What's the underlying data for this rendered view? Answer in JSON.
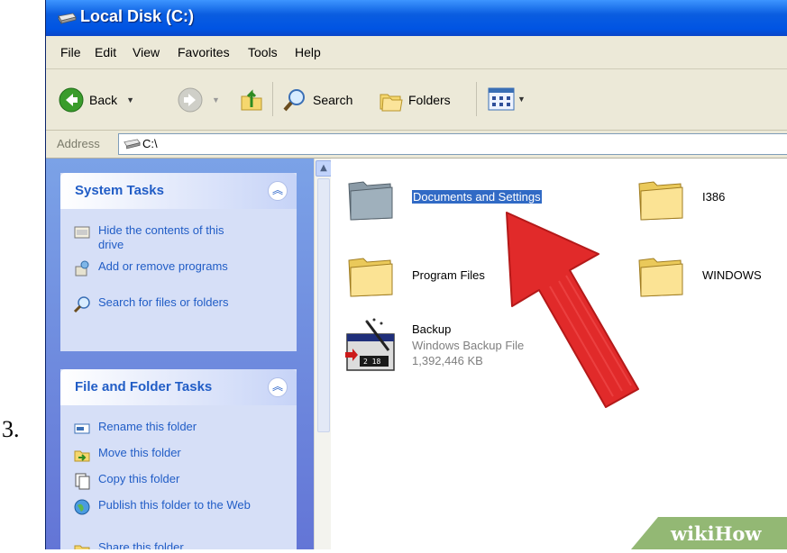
{
  "step_number": "3.",
  "window": {
    "title": "Local Disk (C:)"
  },
  "menu": [
    "File",
    "Edit",
    "View",
    "Favorites",
    "Tools",
    "Help"
  ],
  "toolbar": {
    "back_label": "Back",
    "search_label": "Search",
    "folders_label": "Folders"
  },
  "address": {
    "label": "Address",
    "value": "C:\\"
  },
  "system_tasks": {
    "title": "System Tasks",
    "items": [
      "Hide the contents of this drive",
      "Add or remove programs",
      "Search for files or folders"
    ]
  },
  "file_folder_tasks": {
    "title": "File and Folder Tasks",
    "items": [
      "Rename this folder",
      "Move this folder",
      "Copy this folder",
      "Publish this folder to the Web",
      "Share this folder"
    ]
  },
  "files": {
    "documents": "Documents and Settings",
    "i386": "I386",
    "program_files": "Program Files",
    "windows": "WINDOWS",
    "backup_name": "Backup",
    "backup_type": "Windows Backup File",
    "backup_size": "1,392,446 KB"
  },
  "watermark": "wikiHow",
  "colors": {
    "title_bar": "#0054e3",
    "task_pane": "#7ba2e7",
    "link": "#215dc6",
    "selection": "#316ac5",
    "arrow": "#e8141c"
  }
}
